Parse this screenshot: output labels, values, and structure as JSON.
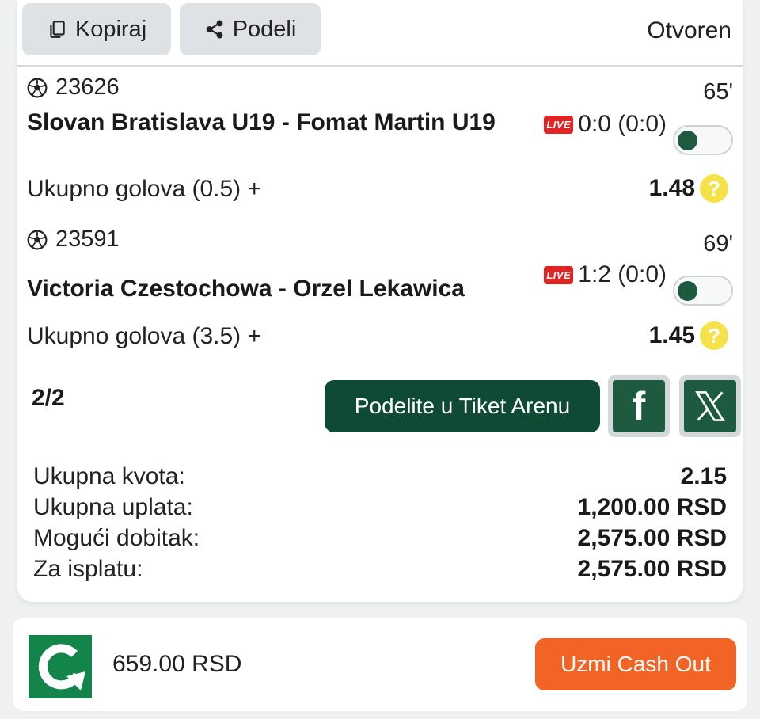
{
  "toolbar": {
    "copy_label": "Kopiraj",
    "share_label": "Podeli",
    "status": "Otvoren"
  },
  "matches": [
    {
      "id": "23626",
      "minute": "65'",
      "teams": "Slovan Bratislava U19 - Fomat Martin U19",
      "live_badge": "LIVE",
      "score": "0:0 (0:0)",
      "bet": "Ukupno golova (0.5) +",
      "odds": "1.48",
      "help": "?"
    },
    {
      "id": "23591",
      "minute": "69'",
      "teams": "Victoria Czestochowa - Orzel Lekawica",
      "live_badge": "LIVE",
      "score": "1:2 (0:0)",
      "bet": "Ukupno golova (3.5) +",
      "odds": "1.45",
      "help": "?"
    }
  ],
  "footer": {
    "count": "2/2",
    "arena_button": "Podelite u Tiket Arenu",
    "facebook_glyph": "f"
  },
  "summary": [
    {
      "label": "Ukupna kvota:",
      "value": "2.15"
    },
    {
      "label": "Ukupna uplata:",
      "value": "1,200.00 RSD"
    },
    {
      "label": "Mogući dobitak:",
      "value": "2,575.00 RSD"
    },
    {
      "label": "Za isplatu:",
      "value": "2,575.00 RSD"
    }
  ],
  "cashout": {
    "amount": "659.00 RSD",
    "button": "Uzmi Cash Out"
  },
  "colors": {
    "brand_green": "#0f4a34",
    "cashout_orange": "#f26426",
    "live_red": "#e02424",
    "help_yellow": "#f5e24a"
  }
}
